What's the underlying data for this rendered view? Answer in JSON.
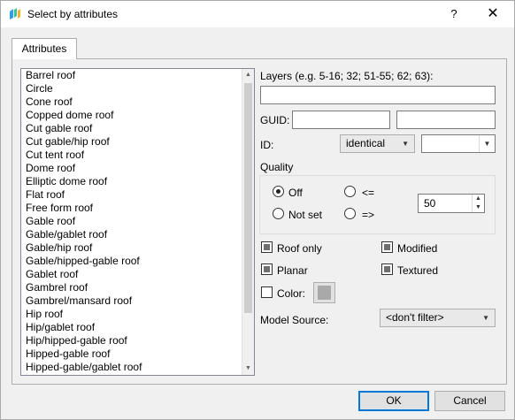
{
  "window": {
    "title": "Select by attributes",
    "help_label": "?",
    "close_label": "✕"
  },
  "tabs": [
    {
      "label": "Attributes",
      "selected": true
    }
  ],
  "roof_list": {
    "items": [
      "Barrel roof",
      "Circle",
      "Cone roof",
      "Copped dome roof",
      "Cut gable roof",
      "Cut gable/hip roof",
      "Cut tent roof",
      "Dome roof",
      "Elliptic dome roof",
      "Flat roof",
      "Free form roof",
      "Gable roof",
      "Gable/gablet roof",
      "Gable/hip roof",
      "Gable/hipped-gable roof",
      "Gablet roof",
      "Gambrel roof",
      "Gambrel/mansard roof",
      "Hip roof",
      "Hip/gablet roof",
      "Hip/hipped-gable roof",
      "Hipped-gable roof",
      "Hipped-gable/gablet roof"
    ]
  },
  "layers": {
    "label": "Layers (e.g. 5-16; 32; 51-55; 62; 63):",
    "value": ""
  },
  "guid": {
    "label": "GUID:",
    "value1": "",
    "value2": ""
  },
  "id": {
    "label": "ID:",
    "operator": "identical",
    "value": ""
  },
  "quality": {
    "label": "Quality",
    "options": {
      "off": "Off",
      "not_set": "Not set",
      "lte": "<=",
      "gte": "=>"
    },
    "selected": "Off",
    "value": "50"
  },
  "filters": {
    "roof_only": "Roof only",
    "modified": "Modified",
    "planar": "Planar",
    "textured": "Textured",
    "state": "partial"
  },
  "color": {
    "label": "Color:",
    "checked": false,
    "swatch": "#a9a9a9"
  },
  "model_source": {
    "label": "Model Source:",
    "value": "<don't filter>"
  },
  "buttons": {
    "ok": "OK",
    "cancel": "Cancel"
  },
  "icons": {
    "app": "app-logo-icon",
    "dropdown": "chevron-down-icon"
  }
}
